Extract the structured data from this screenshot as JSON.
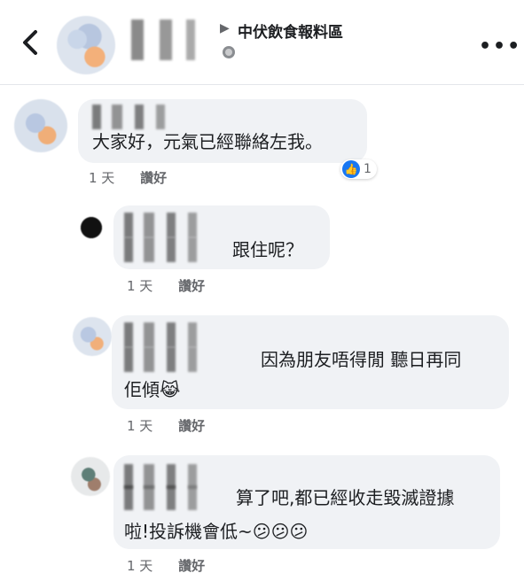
{
  "header": {
    "group_name": "中伏飲食報料區",
    "arrow": "▶",
    "more": "•••"
  },
  "comments": [
    {
      "text": "大家好，元氣已經聯絡左我。",
      "time": "1 天",
      "like": "讚好",
      "reaction_count": "1"
    },
    {
      "text": "跟住呢？",
      "time": "1 天",
      "like": "讚好"
    },
    {
      "text_line1": "因為朋友唔得閒 聽日再同",
      "text_line2": "佢傾😹",
      "time": "1 天",
      "like": "讚好"
    },
    {
      "text_line1": "算了吧,都已經收走毀滅證據",
      "text_line2": "啦!投訴機會低~😕😕😕",
      "time": "1 天",
      "like": "讚好"
    }
  ],
  "icons": {
    "back": "chevron-left-icon",
    "more": "more-dots-icon",
    "privacy": "globe-icon",
    "reaction": "like-reaction-icon"
  }
}
